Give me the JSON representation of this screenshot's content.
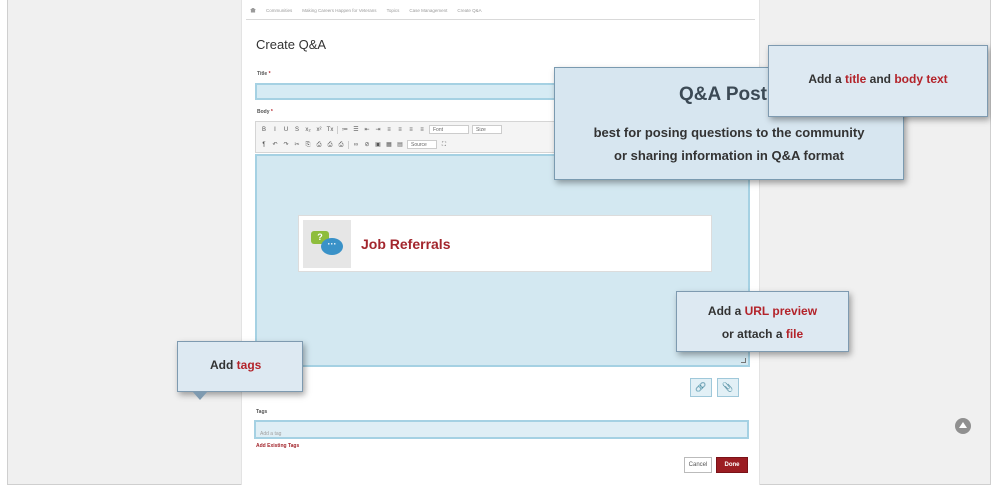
{
  "breadcrumb": [
    "Communities",
    "Making Careers Happen for Veterans",
    "Topics",
    "Case Management",
    "Create Q&A"
  ],
  "page_title": "Create Q&A",
  "form": {
    "title_label": "Title",
    "body_label": "Body",
    "required_mark": "*",
    "tags_label": "Tags",
    "tags_placeholder": "Add a tag",
    "add_existing_tags": "Add Existing Tags",
    "cancel": "Cancel",
    "done": "Done"
  },
  "toolbar": {
    "row1": [
      "B",
      "I",
      "U",
      "S",
      "x₂",
      "x²",
      "Tx",
      "|",
      "≔",
      "☰",
      "⇤",
      "⇥",
      "≡",
      "≡",
      "≡",
      "≡"
    ],
    "font_select": "Font",
    "size_select": "Size",
    "row2": [
      "¶",
      "↶",
      "↷",
      "✂",
      "⎘",
      "⎙",
      "⎙",
      "⎙",
      "|",
      "∞",
      "⊘",
      "▣",
      "▦",
      "▤"
    ],
    "source_label": "Source",
    "maximize": "⛶"
  },
  "embed": {
    "title": "Job Referrals",
    "icon": "speech-bubbles-icon"
  },
  "callouts": {
    "qa_post": {
      "heading": "Q&A Post",
      "line1": "best for posing questions to the community",
      "line2": "or sharing information in Q&A format"
    },
    "title_tip": {
      "prefix": "Add a ",
      "title_word": "title",
      "middle": " and ",
      "body_word": "body text"
    },
    "url_tip": {
      "l1_prefix": "Add a ",
      "l1_red": "URL preview",
      "l2_prefix": "or attach a ",
      "l2_red": "file"
    },
    "tags_tip": {
      "prefix": "Add ",
      "red": "tags"
    }
  },
  "attachments": {
    "link_icon": "🔗",
    "paperclip_icon": "📎"
  },
  "colors": {
    "accent": "#9b1c22",
    "highlight": "#d3e8f1",
    "highlight_border": "#a5d1e3",
    "callout_bg": "#dde9f2"
  }
}
